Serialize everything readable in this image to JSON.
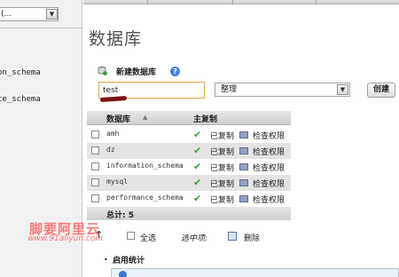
{
  "navigation": {
    "db_select": {
      "value": "(..."
    },
    "databases": [
      "on_schema",
      "ce_schema"
    ]
  },
  "page": {
    "title": "数据库"
  },
  "create_db": {
    "label": "新建数据库",
    "name_value": "test",
    "collation_value": "整理",
    "button_label": "创建"
  },
  "table": {
    "columns": [
      "数据库",
      "主复制"
    ],
    "rows": [
      {
        "name": "amh",
        "replication": "已复制",
        "priv_link": "检查权限"
      },
      {
        "name": "dz",
        "replication": "已复制",
        "priv_link": "检查权限"
      },
      {
        "name": "information_schema",
        "replication": "已复制",
        "priv_link": "检查权限"
      },
      {
        "name": "mysql",
        "replication": "已复制",
        "priv_link": "检查权限"
      },
      {
        "name": "performance_schema",
        "replication": "已复制",
        "priv_link": "检查权限"
      }
    ],
    "total": "总计: 5"
  },
  "bulk_actions": {
    "check_all": "全选",
    "with_selected": "选中项:",
    "drop": "删除"
  },
  "statistics": {
    "label": "启用统计"
  },
  "watermark": {
    "brand": "脚要阿里云",
    "url": "www.91aliyun.com"
  },
  "icons": {
    "create": "new-database-icon",
    "help": "help-icon",
    "check": "check-icon",
    "privileges": "privileges-icon",
    "drop": "drop-icon",
    "arrow": "arrow-up-icon"
  },
  "colors": {
    "check": "#3aa43a",
    "input_border": "#e0a64a",
    "row_alt": "#e4e4e4"
  }
}
